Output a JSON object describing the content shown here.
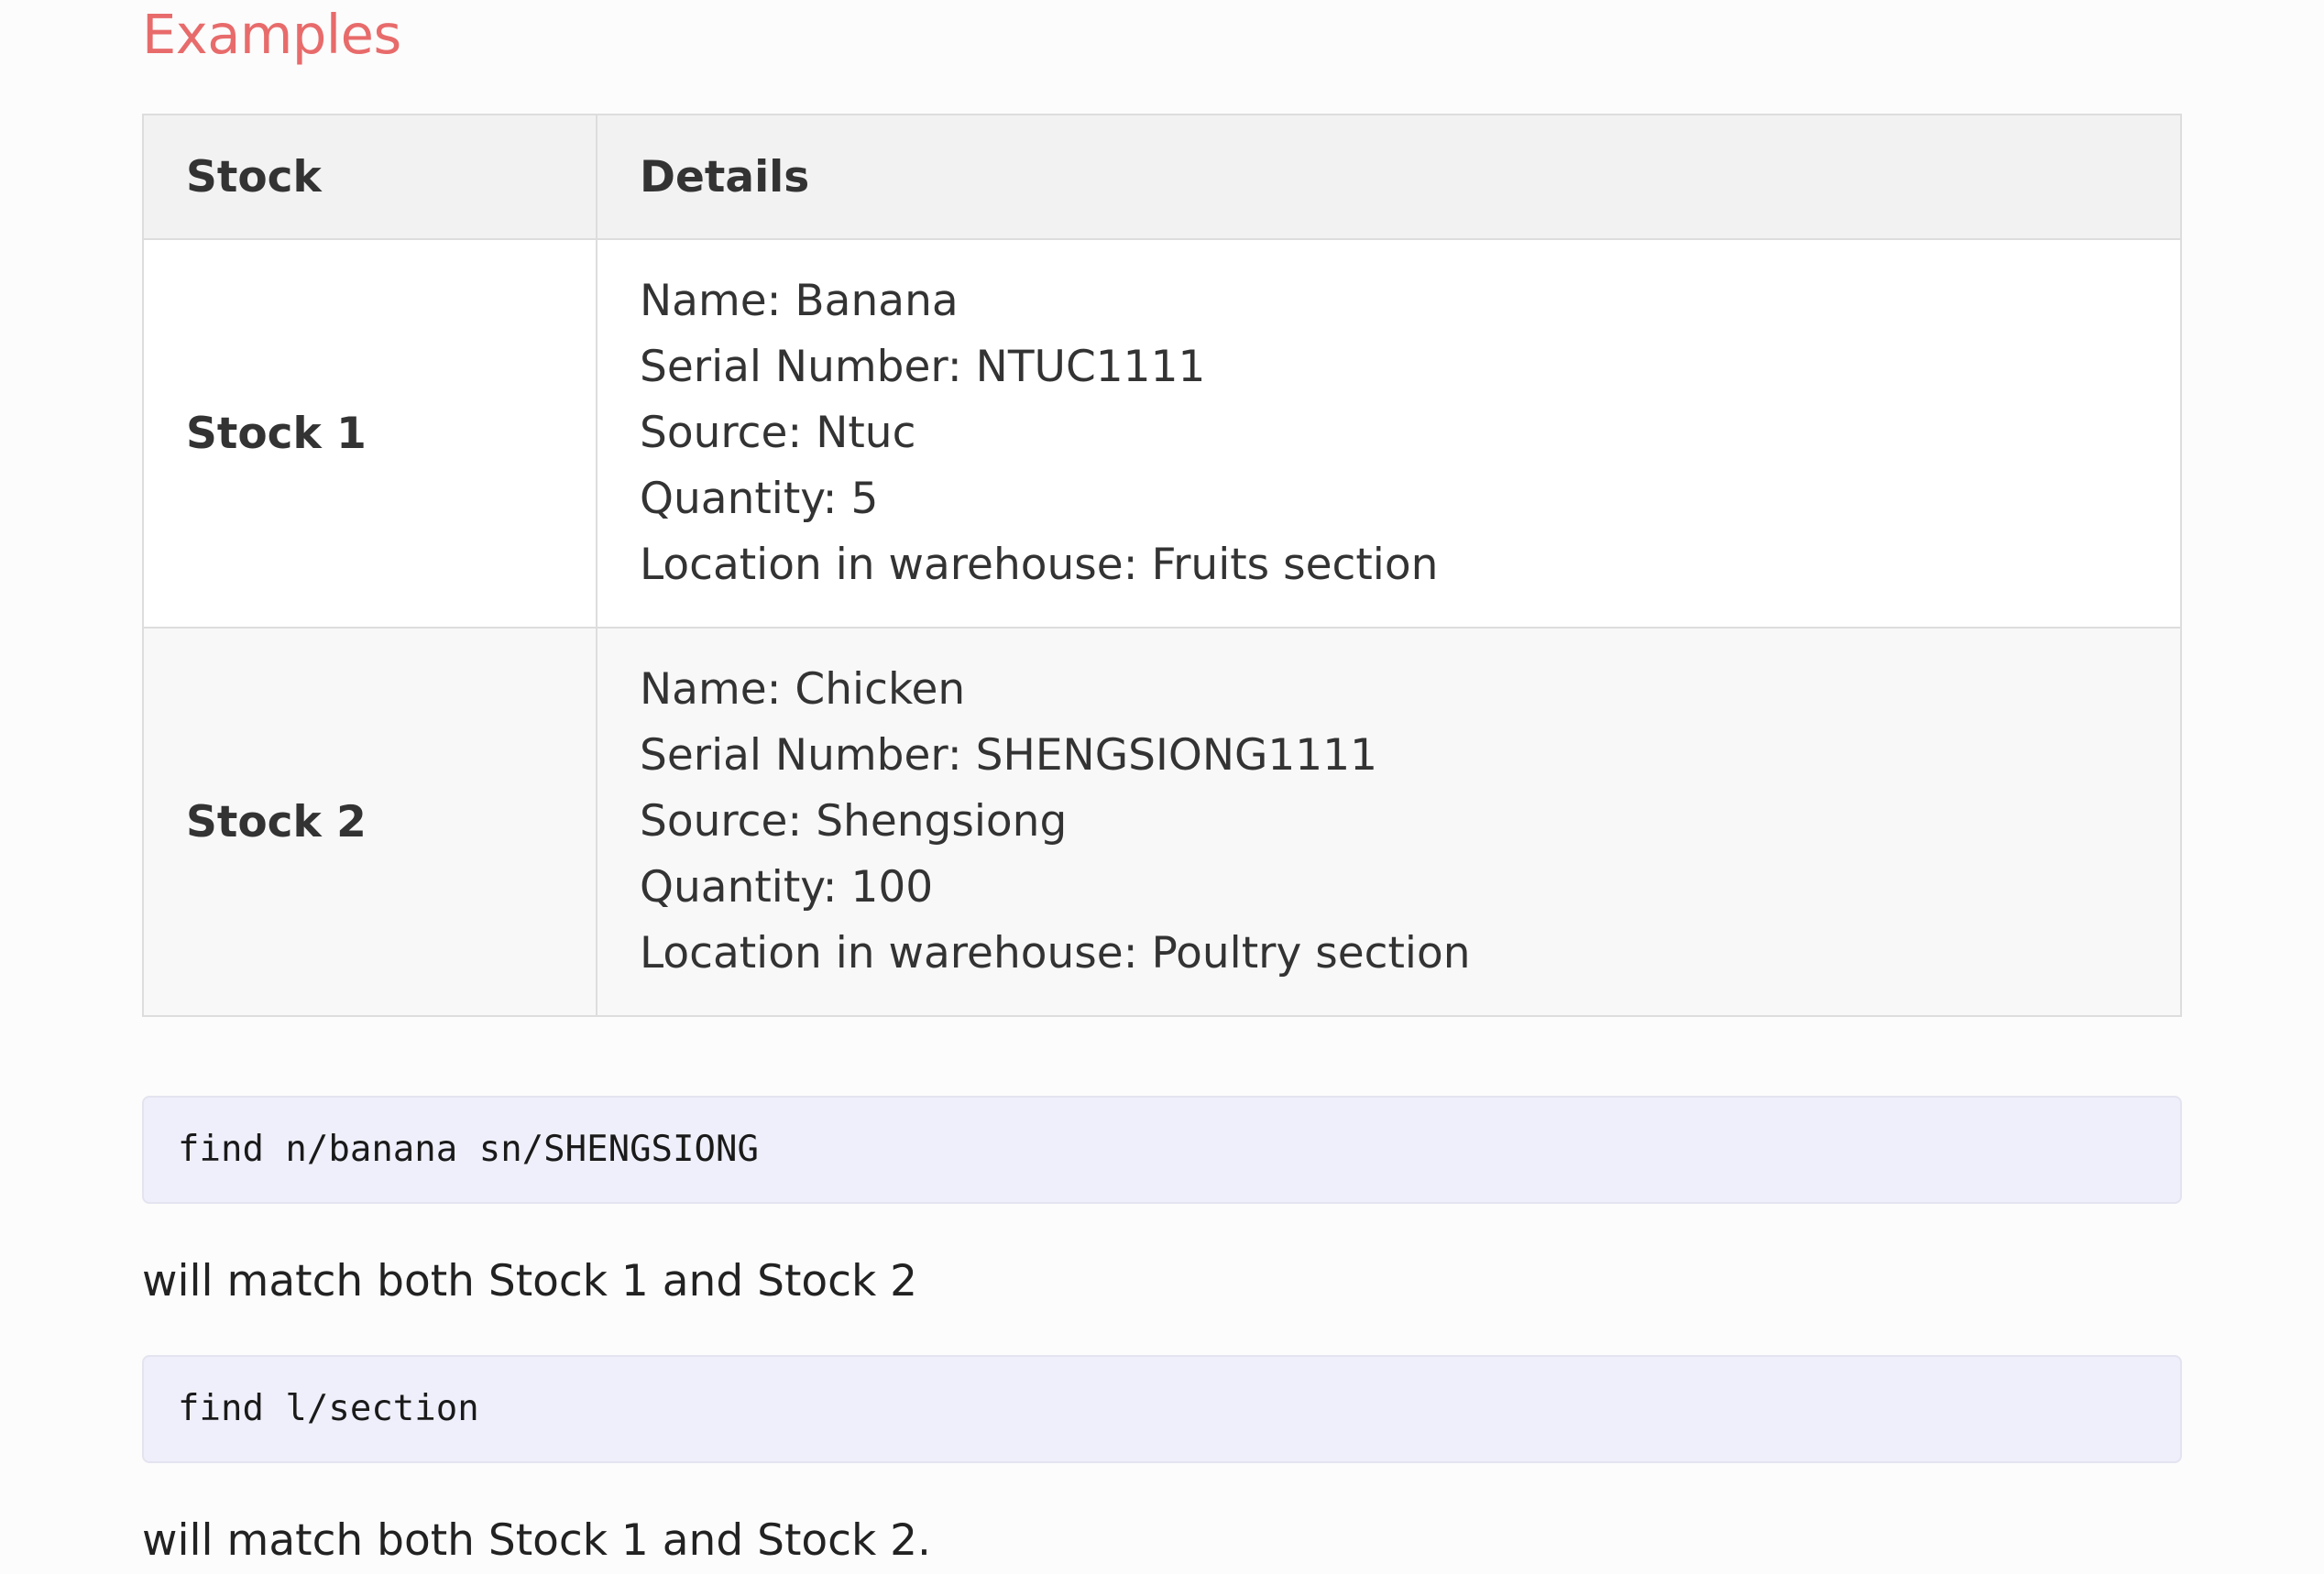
{
  "heading": "Examples",
  "table": {
    "headers": {
      "stock": "Stock",
      "details": "Details"
    },
    "rows": [
      {
        "stock": "Stock 1",
        "details": [
          "Name: Banana",
          "Serial Number: NTUC1111",
          "Source: Ntuc",
          "Quantity: 5",
          "Location in warehouse: Fruits section"
        ]
      },
      {
        "stock": "Stock 2",
        "details": [
          "Name: Chicken",
          "Serial Number: SHENGSIONG1111",
          "Source: Shengsiong",
          "Quantity: 100",
          "Location in warehouse: Poultry section"
        ]
      }
    ]
  },
  "examples": [
    {
      "command": "find n/banana sn/SHENGSIONG",
      "result": "will match both Stock 1 and Stock 2"
    },
    {
      "command": "find l/section",
      "result": "will match both Stock 1 and Stock 2."
    }
  ],
  "colors": {
    "heading": "#e86b6b",
    "code_background": "#efeffb",
    "table_header_background": "#f2f2f2",
    "table_border": "#dddddd"
  }
}
